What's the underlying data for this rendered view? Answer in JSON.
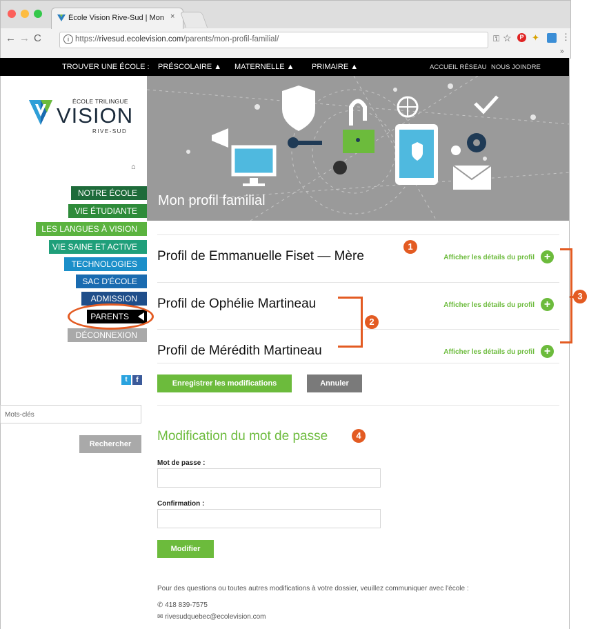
{
  "browser": {
    "tab_title": "École Vision Rive-Sud | Mon pr",
    "tab_close": "×",
    "url_scheme": "https://",
    "url_domain": "rivesud.ecolevision.com",
    "url_path": "/parents/mon-profil-familial/",
    "overflow": "»"
  },
  "top_menu": {
    "find_school": "TROUVER UNE ÉCOLE :",
    "items": [
      "PRÉSCOLAIRE ▲",
      "MATERNELLE ▲",
      "PRIMAIRE ▲"
    ],
    "right_links": [
      "ACCUEIL RÉSEAU",
      "NOUS JOINDRE"
    ]
  },
  "logo": {
    "line1": "ÉCOLE TRILINGUE",
    "line2": "VISION",
    "line3": "RIVE-SUD"
  },
  "sidebar": {
    "items": [
      {
        "label": "NOTRE ÉCOLE",
        "color": "#1e6b3a"
      },
      {
        "label": "VIE ÉTUDIANTE",
        "color": "#2e8b3a"
      },
      {
        "label": "LES LANGUES À VISION",
        "color": "#5bb33f"
      },
      {
        "label": "VIE SAINE ET ACTIVE",
        "color": "#1f9f7a"
      },
      {
        "label": "TECHNOLOGIES",
        "color": "#1b8fc9"
      },
      {
        "label": "SAC D'ÉCOLE",
        "color": "#1a6bb0"
      },
      {
        "label": "ADMISSION",
        "color": "#1f4e8a"
      },
      {
        "label": "PARENTS",
        "color": "#000000"
      },
      {
        "label": "DÉCONNEXION",
        "color": "#a9a9a9"
      }
    ],
    "search_placeholder": "Mots-clés",
    "search_button": "Rechercher"
  },
  "banner": {
    "title": "Mon profil familial"
  },
  "profiles": [
    {
      "name": "Profil de Emmanuelle Fiset — Mère",
      "link": "Afficher les détails du profil"
    },
    {
      "name": "Profil de Ophélie Martineau",
      "link": "Afficher les détails du profil"
    },
    {
      "name": "Profil de Mérédith Martineau",
      "link": "Afficher les détails du profil"
    }
  ],
  "buttons": {
    "save": "Enregistrer les modifications",
    "cancel": "Annuler",
    "modify": "Modifier"
  },
  "password": {
    "title": "Modification du mot de passe",
    "password_label": "Mot de passe :",
    "confirm_label": "Confirmation :"
  },
  "footer": {
    "note": "Pour des questions ou toutes autres modifications à votre dossier, veuillez communiquer avec l'école :",
    "phone": "418 839-7575",
    "email": "rivesudquebec@ecolevision.com"
  },
  "annotations": [
    "1",
    "2",
    "3",
    "4"
  ],
  "colors": {
    "accent_green": "#6cbb3c",
    "annotation_orange": "#e35b22"
  }
}
